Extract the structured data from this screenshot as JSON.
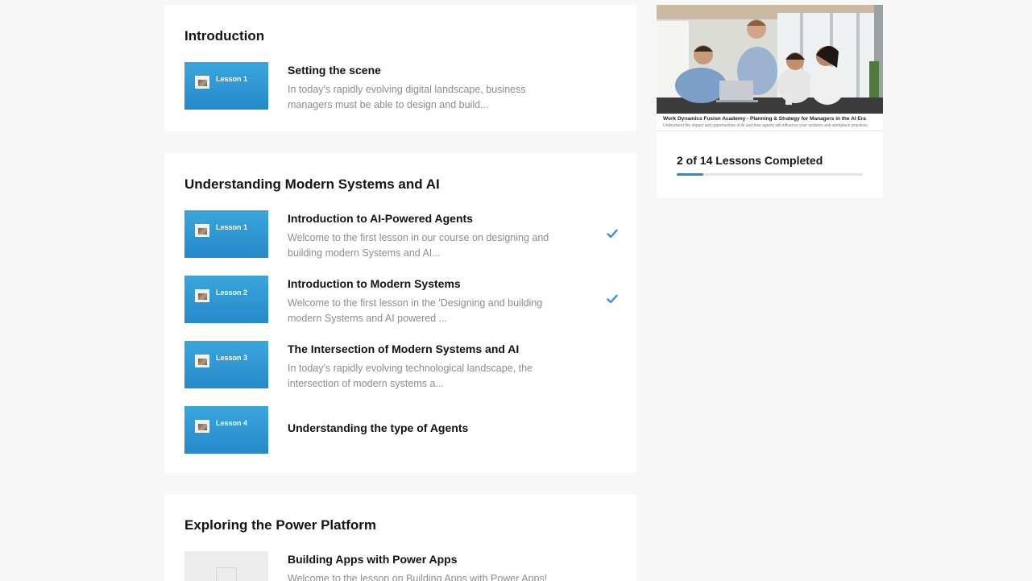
{
  "sections": [
    {
      "title": "Introduction",
      "lessons": [
        {
          "thumb_label": "Lesson 1",
          "title": "Setting the scene",
          "desc": "In today's rapidly evolving digital landscape, business managers must be able to design and build...",
          "completed": false
        }
      ]
    },
    {
      "title": "Understanding Modern Systems and AI",
      "lessons": [
        {
          "thumb_label": "Lesson 1",
          "title": "Introduction to AI-Powered Agents",
          "desc": "Welcome to the first lesson in our course on designing and building modern Systems and AI...",
          "completed": true
        },
        {
          "thumb_label": "Lesson 2",
          "title": "Introduction to Modern Systems",
          "desc": "Welcome to the first lesson in the 'Designing and building modern Systems and AI powered ...",
          "completed": true
        },
        {
          "thumb_label": "Lesson 3",
          "title": "The Intersection of Modern Systems and AI",
          "desc": "In today's rapidly evolving technological landscape, the intersection of modern systems a...",
          "completed": false
        },
        {
          "thumb_label": "Lesson 4",
          "title": "Understanding the type of Agents",
          "desc": "",
          "completed": false
        }
      ]
    },
    {
      "title": "Exploring the Power Platform",
      "lessons": [
        {
          "thumb_label": "",
          "title": "Building Apps with Power Apps",
          "desc": "Welcome to the lesson on Building Apps with Power Apps!",
          "completed": false
        }
      ]
    }
  ],
  "course_card": {
    "caption_title": "Work Dynamics Fusion Academy - Planning & Strategy for Managers in the AI Era",
    "caption_subtitle": "Understand the impact and opportunities of AI and how agents will influence your systems and workplace practices",
    "progress_text": "2 of 14 Lessons Completed",
    "progress_fraction": 0.143
  },
  "icons": {
    "completed": "check-icon",
    "thumbnail": "image-icon"
  },
  "colors": {
    "accent": "#2e86d6",
    "thumbnail": "#2f98d6",
    "check": "#3b8ee0",
    "background": "#f7f7f7"
  }
}
